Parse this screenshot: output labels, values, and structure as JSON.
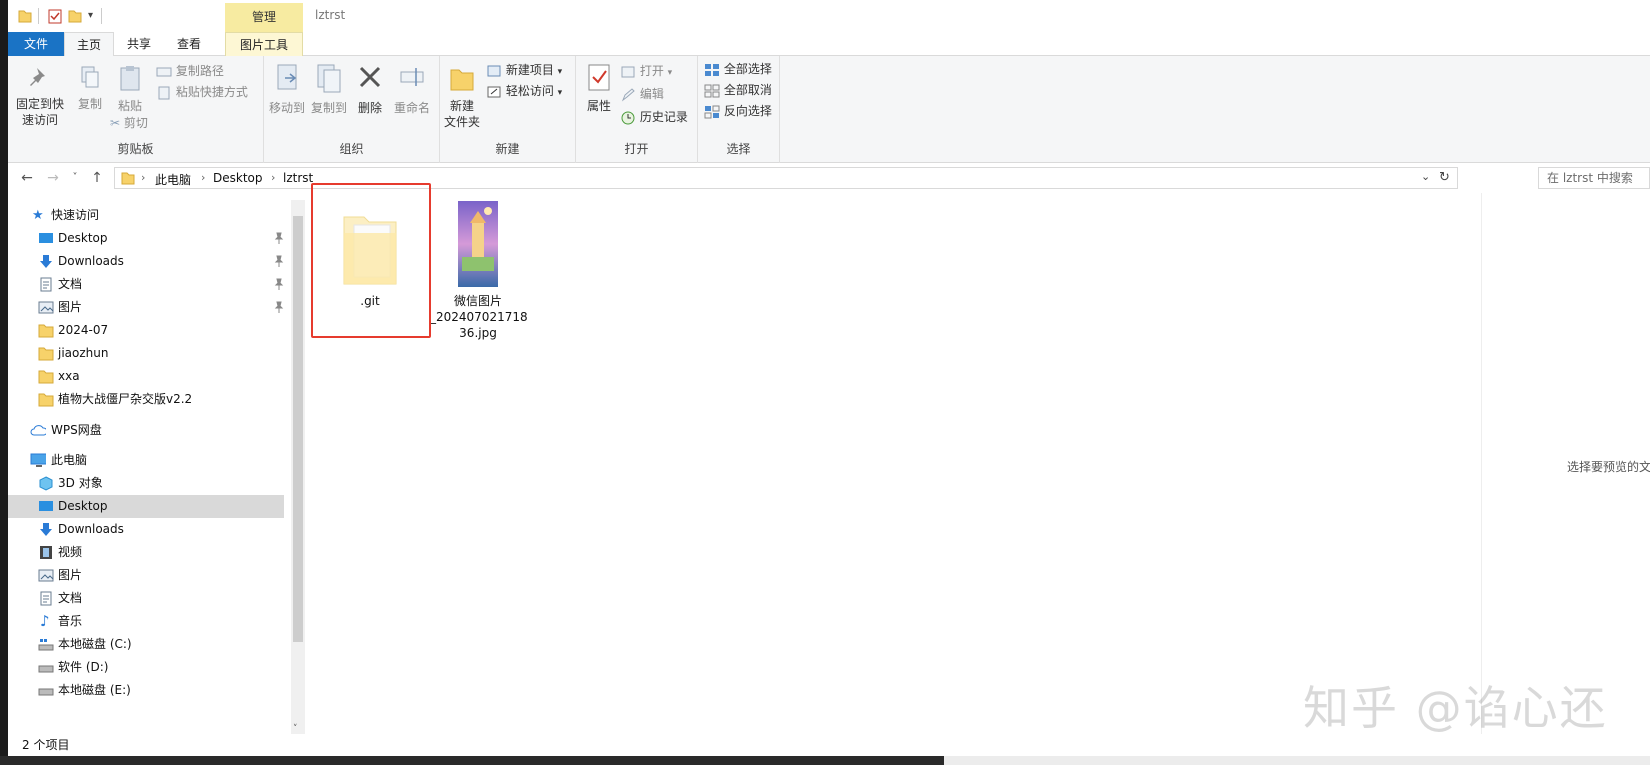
{
  "window": {
    "title": "lztrst",
    "context_tab_group": "管理"
  },
  "tabs": [
    {
      "label": "文件"
    },
    {
      "label": "主页"
    },
    {
      "label": "共享"
    },
    {
      "label": "查看"
    },
    {
      "label": "图片工具"
    }
  ],
  "ribbon": {
    "clipboard": {
      "label": "剪贴板",
      "pin": "固定到快速访问",
      "pin_line1": "固定到快",
      "pin_line2": "速访问",
      "copy": "复制",
      "paste": "粘贴",
      "copy_path": "复制路径",
      "paste_shortcut": "粘贴快捷方式",
      "cut": "剪切"
    },
    "organize": {
      "label": "组织",
      "move_to": "移动到",
      "copy_to": "复制到",
      "delete": "删除",
      "rename": "重命名"
    },
    "new": {
      "label": "新建",
      "new_folder_line1": "新建",
      "new_folder_line2": "文件夹",
      "new_item": "新建项目",
      "easy_access": "轻松访问"
    },
    "open": {
      "label": "打开",
      "properties": "属性",
      "open": "打开",
      "edit": "编辑",
      "history": "历史记录"
    },
    "select": {
      "label": "选择",
      "select_all": "全部选择",
      "select_none": "全部取消",
      "invert": "反向选择"
    }
  },
  "address": {
    "crumbs": [
      "此电脑",
      "Desktop",
      "lztrst"
    ],
    "search_placeholder": "在 lztrst 中搜索"
  },
  "nav": {
    "quick_access": "快速访问",
    "quick_items": [
      {
        "label": "Desktop",
        "pinned": true
      },
      {
        "label": "Downloads",
        "pinned": true
      },
      {
        "label": "文档",
        "pinned": true
      },
      {
        "label": "图片",
        "pinned": true
      },
      {
        "label": "2024-07",
        "pinned": false
      },
      {
        "label": "jiaozhun",
        "pinned": false
      },
      {
        "label": "xxa",
        "pinned": false
      },
      {
        "label": "植物大战僵尸杂交版v2.2",
        "pinned": false
      }
    ],
    "wps": "WPS网盘",
    "this_pc": "此电脑",
    "pc_items": [
      {
        "label": "3D 对象"
      },
      {
        "label": "Desktop",
        "selected": true
      },
      {
        "label": "Downloads"
      },
      {
        "label": "视频"
      },
      {
        "label": "图片"
      },
      {
        "label": "文档"
      },
      {
        "label": "音乐"
      },
      {
        "label": "本地磁盘 (C:)"
      },
      {
        "label": "软件 (D:)"
      },
      {
        "label": "本地磁盘 (E:)"
      }
    ]
  },
  "files": [
    {
      "name": ".git",
      "type": "folder"
    },
    {
      "name_line1": "微信图片",
      "name_line2": "_202407021718",
      "name_line3": "36.jpg",
      "type": "image"
    }
  ],
  "preview_text": "选择要预览的文件",
  "status": "2 个项目",
  "watermark": "知乎 @谄心还",
  "colors": {
    "file_tab": "#1a73c5",
    "manage_tab": "#f7eba1",
    "highlight_box": "#e63b2e",
    "selected_nav": "#d9d9d9"
  }
}
